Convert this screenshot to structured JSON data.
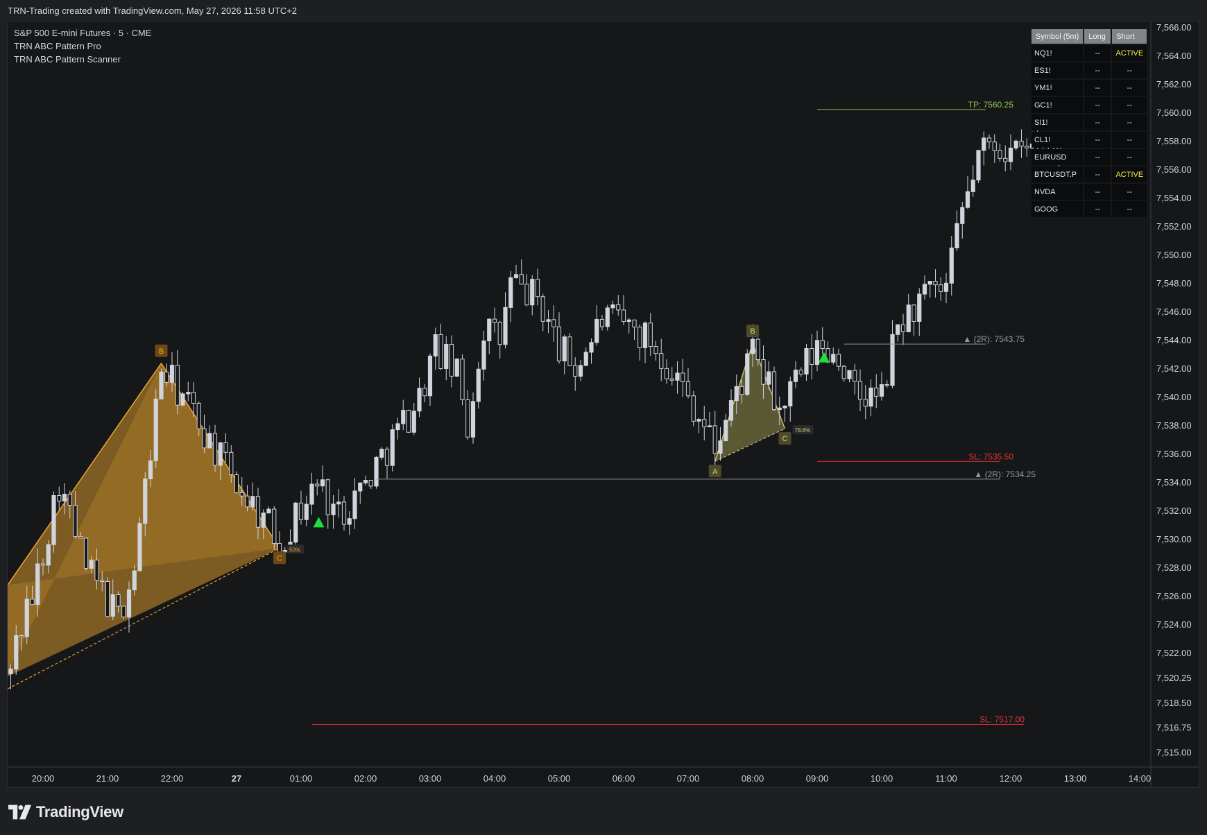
{
  "header": {
    "attribution": "TRN-Trading created with TradingView.com, May 27, 2026 11:58 UTC+2"
  },
  "legend": {
    "symbol_line": "S&P 500 E-mini Futures · 5 · CME",
    "indicator_1": "TRN ABC Pattern Pro",
    "indicator_2": "TRN ABC Pattern Scanner"
  },
  "scanner": {
    "headers": [
      "Symbol (5m)",
      "Long",
      "Short"
    ],
    "rows": [
      {
        "symbol": "NQ1!",
        "long": "--",
        "short": "ACTIVE"
      },
      {
        "symbol": "ES1!",
        "long": "--",
        "short": "--"
      },
      {
        "symbol": "YM1!",
        "long": "--",
        "short": "--"
      },
      {
        "symbol": "GC1!",
        "long": "--",
        "short": "--"
      },
      {
        "symbol": "SI1!",
        "long": "--",
        "short": "--"
      },
      {
        "symbol": "CL1!",
        "long": "--",
        "short": "--"
      },
      {
        "symbol": "EURUSD",
        "long": "--",
        "short": "--"
      },
      {
        "symbol": "BTCUSDT.P",
        "long": "--",
        "short": "ACTIVE"
      },
      {
        "symbol": "NVDA",
        "long": "--",
        "short": "--"
      },
      {
        "symbol": "GOOG",
        "long": "--",
        "short": "--"
      }
    ]
  },
  "footer": {
    "brand": "TradingView"
  },
  "colors": {
    "background": "#161719",
    "candle": "#d1d4dc",
    "pattern1_fill": "#9a6f27",
    "pattern1_line": "#f0a530",
    "pattern2_fill": "#6f6a3c",
    "pattern2_line": "#c7bd72",
    "tp": "#8bc34a",
    "sl": "#e03535",
    "signal": "#1de03a",
    "active": "#f5e94a"
  },
  "chart_data": {
    "type": "candlestick",
    "symbol": "S&P 500 E-mini Futures",
    "timeframe": "5",
    "exchange": "CME",
    "x_labels": [
      "20:00",
      "21:00",
      "22:00",
      "27",
      "01:00",
      "02:00",
      "03:00",
      "04:00",
      "05:00",
      "06:00",
      "07:00",
      "08:00",
      "09:00",
      "10:00",
      "11:00",
      "12:00",
      "13:00",
      "14:00"
    ],
    "y_labels": [
      "7,566.00",
      "7,564.00",
      "7,562.00",
      "7,560.00",
      "7,558.00",
      "7,556.00",
      "7,554.00",
      "7,552.00",
      "7,550.00",
      "7,548.00",
      "7,546.00",
      "7,544.00",
      "7,542.00",
      "7,540.00",
      "7,538.00",
      "7,536.00",
      "7,534.00",
      "7,532.00",
      "7,530.00",
      "7,528.00",
      "7,526.00",
      "7,524.00",
      "7,522.00",
      "7,520.25",
      "7,518.50",
      "7,516.75",
      "7,515.00"
    ],
    "ylim": [
      7514.0,
      7567.0
    ],
    "patterns": [
      {
        "label_a": "A",
        "label_b": "B",
        "label_c": "C",
        "a": {
          "time": "19:25",
          "price": 7520.3
        },
        "b": {
          "time": "21:50",
          "price": 7542.4
        },
        "c": {
          "time": "23:40",
          "price": 7529.4
        },
        "retracement": "50%"
      },
      {
        "label_a": "A",
        "label_b": "B",
        "label_c": "C",
        "a": {
          "time": "06:25",
          "price": 7535.5
        },
        "b": {
          "time": "07:00",
          "price": 7543.8
        },
        "c": {
          "time": "07:30",
          "price": 7537.8
        },
        "retracement": "78.6%"
      }
    ],
    "levels": [
      {
        "label": "TP: 7560.25",
        "price": 7560.25,
        "kind": "tp",
        "start": "08:00"
      },
      {
        "label": "▲ (2R): 7543.75",
        "price": 7543.75,
        "kind": "target",
        "start": "08:25"
      },
      {
        "label": "SL: 7535.50",
        "price": 7535.5,
        "kind": "sl",
        "start": "08:00"
      },
      {
        "label": "▲ (2R): 7534.25",
        "price": 7534.25,
        "kind": "target",
        "start": "01:10"
      },
      {
        "label": "SL: 7517.00",
        "price": 7517.0,
        "kind": "sl",
        "start": "00:10"
      }
    ],
    "signals": [
      {
        "time": "00:10",
        "price": 7531.2,
        "direction": "long"
      },
      {
        "time": "08:00",
        "price": 7542.8,
        "direction": "long"
      }
    ],
    "ohlc_anchors": [
      [
        "19:25",
        7520.5
      ],
      [
        "19:50",
        7526.0
      ],
      [
        "20:15",
        7534.0
      ],
      [
        "20:40",
        7528.0
      ],
      [
        "21:10",
        7524.5
      ],
      [
        "21:25",
        7528.0
      ],
      [
        "21:50",
        7542.0
      ],
      [
        "22:15",
        7539.5
      ],
      [
        "22:50",
        7535.0
      ],
      [
        "23:30",
        7531.0
      ],
      [
        "23:40",
        7529.8
      ],
      [
        "00:15",
        7534.0
      ],
      [
        "00:35",
        7531.8
      ],
      [
        "01:00",
        7534.0
      ],
      [
        "01:20",
        7536.5
      ],
      [
        "01:50",
        7540.0
      ],
      [
        "02:05",
        7543.5
      ],
      [
        "02:25",
        7541.5
      ],
      [
        "02:35",
        7538.0
      ],
      [
        "02:50",
        7545.0
      ],
      [
        "03:05",
        7544.0
      ],
      [
        "03:15",
        7548.0
      ],
      [
        "03:40",
        7547.0
      ],
      [
        "04:00",
        7543.5
      ],
      [
        "04:15",
        7542.0
      ],
      [
        "04:40",
        7545.5
      ],
      [
        "05:05",
        7545.0
      ],
      [
        "05:25",
        7544.0
      ],
      [
        "05:45",
        7542.0
      ],
      [
        "06:05",
        7539.5
      ],
      [
        "06:25",
        7536.5
      ],
      [
        "06:35",
        7538.5
      ],
      [
        "07:00",
        7543.0
      ],
      [
        "07:25",
        7539.0
      ],
      [
        "07:40",
        7541.0
      ],
      [
        "08:00",
        7543.5
      ],
      [
        "08:20",
        7543.0
      ],
      [
        "08:35",
        7540.0
      ],
      [
        "09:00",
        7540.0
      ],
      [
        "09:15",
        7545.0
      ],
      [
        "09:40",
        7547.0
      ],
      [
        "10:00",
        7547.5
      ],
      [
        "10:15",
        7553.0
      ],
      [
        "10:30",
        7557.0
      ],
      [
        "10:45",
        7558.0
      ],
      [
        "11:05",
        7557.0
      ],
      [
        "11:30",
        7558.0
      ],
      [
        "11:45",
        7558.0
      ]
    ]
  }
}
